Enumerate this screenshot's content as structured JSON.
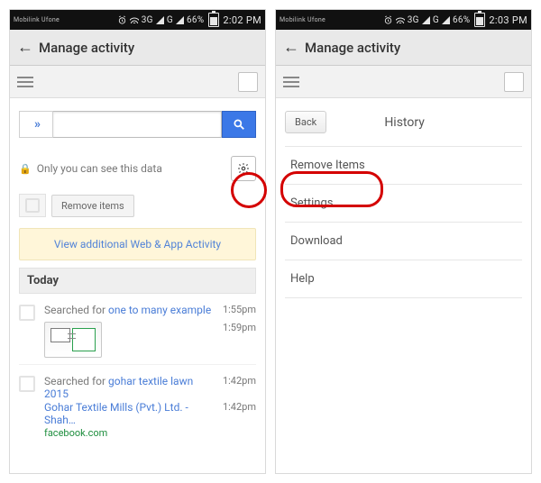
{
  "left": {
    "status": {
      "carrier": "Mobilink Ufone",
      "net1": "3G",
      "net2": "G",
      "battery": "66%",
      "time": "2:02 PM"
    },
    "appbar_title": "Manage activity",
    "search": {
      "placeholder": ""
    },
    "privacy_note": "Only you can see this data",
    "remove_label": "Remove items",
    "banner_label": "View additional Web & App Activity",
    "section_today": "Today",
    "entries": [
      {
        "prefix": "Searched for ",
        "link": "one to many example",
        "time": "1:55pm",
        "thumb_time": "1:59pm"
      },
      {
        "prefix": "Searched for ",
        "link": "gohar textile lawn 2015",
        "time": "1:42pm",
        "sub": "Gohar Textile Mills (Pvt.) Ltd. - Shah…",
        "sub_time": "1:42pm",
        "green": "facebook.com"
      }
    ]
  },
  "right": {
    "status": {
      "carrier": "Mobilink Ufone",
      "net1": "3G",
      "net2": "G",
      "battery": "66%",
      "time": "2:03 PM"
    },
    "appbar_title": "Manage activity",
    "back_label": "Back",
    "title": "History",
    "menu": {
      "remove": "Remove Items",
      "settings": "Settings",
      "download": "Download",
      "help": "Help"
    }
  }
}
